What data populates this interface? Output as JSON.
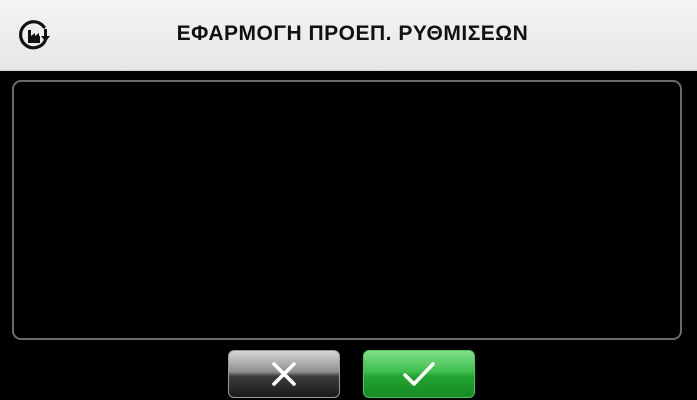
{
  "header": {
    "title": "ΕΦΑΡΜΟΓΗ ΠΡΟΕΠ. ΡΥΘΜΙΣΕΩΝ",
    "icon": "factory-reset-icon"
  },
  "content": {
    "text": ""
  },
  "buttons": {
    "cancel": {
      "icon": "close-icon",
      "color": "#2a2a2a"
    },
    "confirm": {
      "icon": "checkmark-icon",
      "color": "#2fb83e"
    }
  }
}
